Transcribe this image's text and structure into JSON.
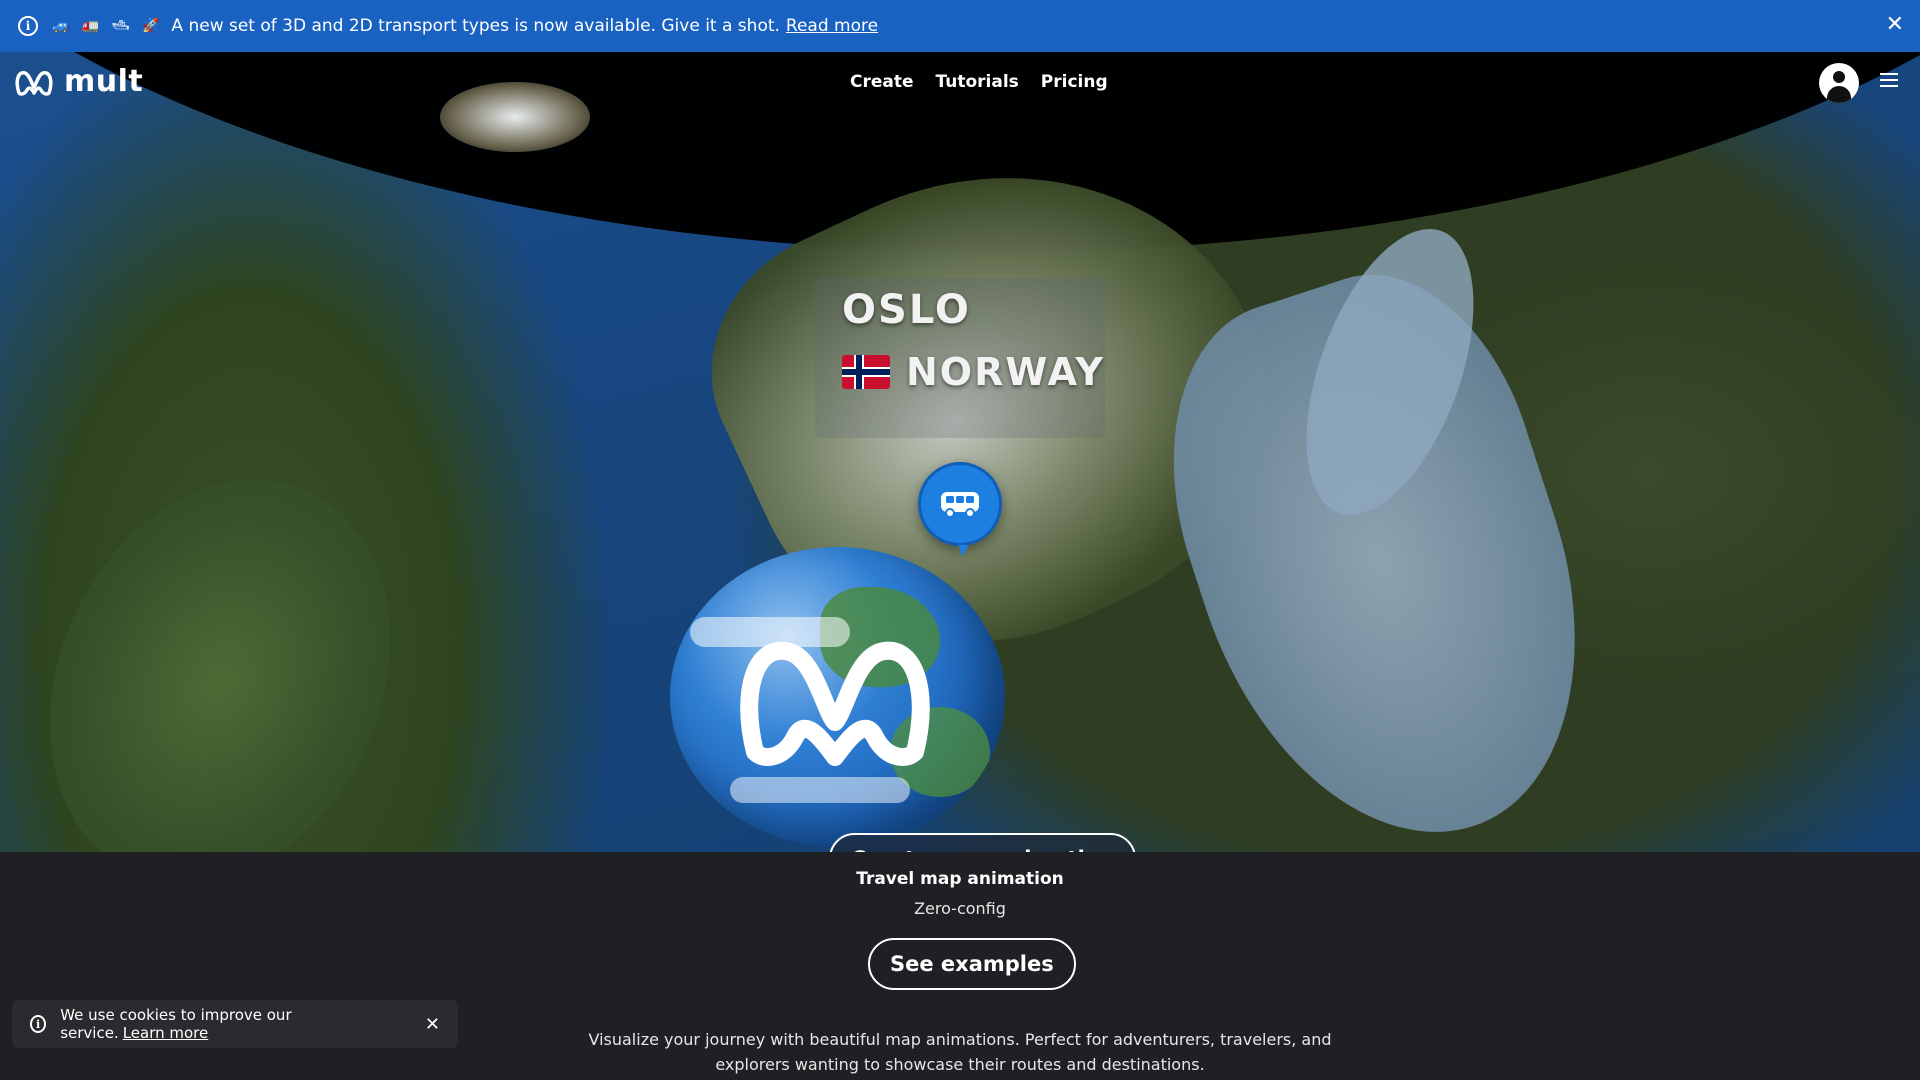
{
  "announcement": {
    "emojis": "🚙 🚛 🛥 🚀",
    "text": "A new set of 3D and 2D transport types is now available. Give it a shot.",
    "link": "Read more",
    "close": "✕"
  },
  "brand": {
    "name": "mult"
  },
  "nav": {
    "links": [
      "Create",
      "Tutorials",
      "Pricing"
    ]
  },
  "map": {
    "city": "OSLO",
    "country": "NORWAY",
    "cta": "Create map animation"
  },
  "hero_info": {
    "subtitle": "Travel map animation",
    "tagline": "Zero-config",
    "examples_button": "See examples",
    "description": "Visualize your journey with beautiful map animations. Perfect for adventurers, travelers, and explorers wanting to showcase their routes and destinations."
  },
  "cookie": {
    "text": "We use cookies to improve our service.",
    "link": "Learn more",
    "close": "✕"
  },
  "colors": {
    "banner": "#1a62c2",
    "background": "#1f2023",
    "marker": "#1d7fe0"
  }
}
